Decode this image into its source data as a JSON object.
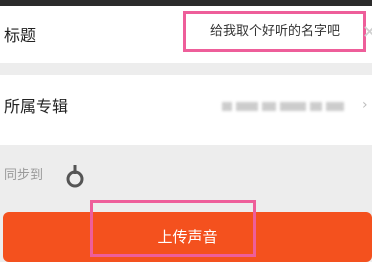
{
  "form": {
    "title_row": {
      "label": "标题",
      "input_value": "",
      "input_placeholder": "给我取个好听的名字吧"
    },
    "album_row": {
      "label": "所属专辑"
    },
    "sync_row": {
      "label": "同步到",
      "icon": "sync-target-icon"
    }
  },
  "upload": {
    "button_label": "上传声音"
  },
  "colors": {
    "accent": "#f4511e",
    "highlight": "#ee5e9a"
  }
}
